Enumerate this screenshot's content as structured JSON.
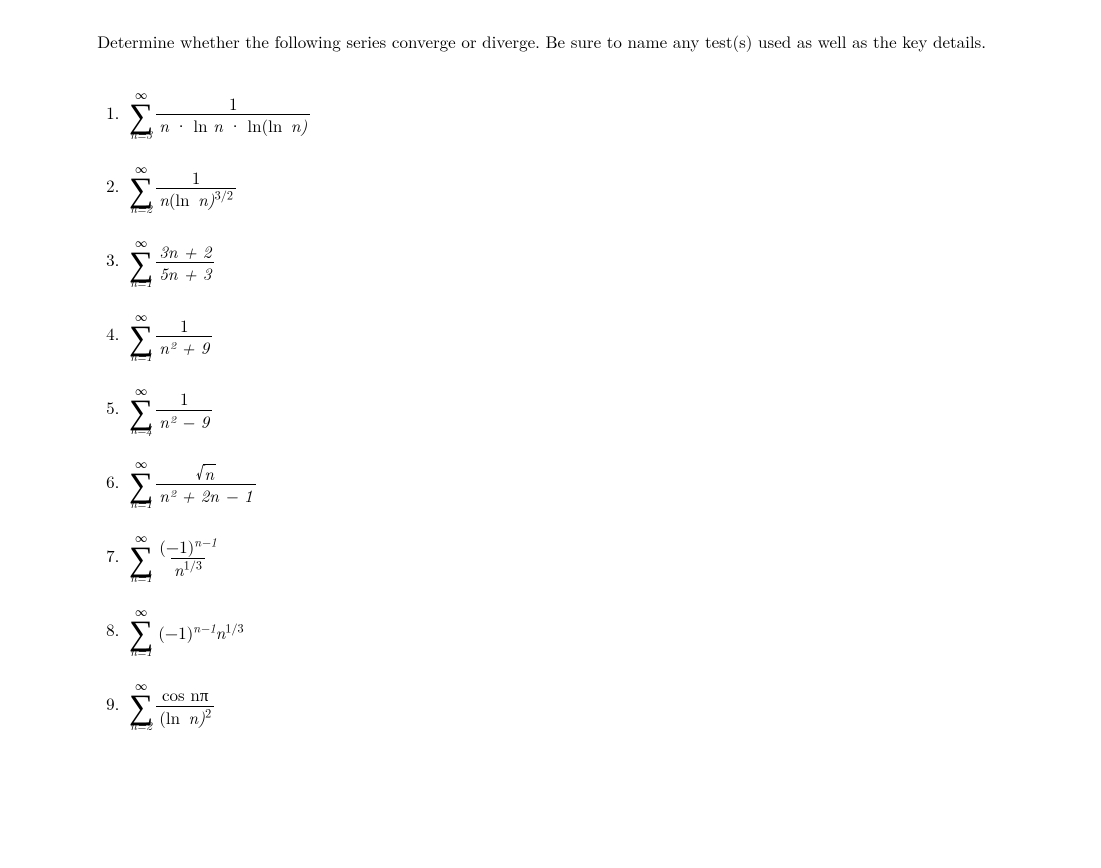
{
  "prompt": "Determine whether the following series converge or diverge. Be sure to name any test(s) used as well as the key details.",
  "sigma": {
    "symbol": "∑",
    "upper": "∞"
  },
  "problems": {
    "p1": {
      "lower": "n=3",
      "num": "1",
      "den_left": "n",
      "den_ln": "ln",
      "den_lnofln_l": "ln(ln",
      "den_lnofln_r": "n)"
    },
    "p2": {
      "lower": "n=2",
      "num": "1",
      "den_n": "n",
      "den_ln": "(ln",
      "den_n2": "n)",
      "den_exp": "3/2"
    },
    "p3": {
      "lower": "n=1",
      "num": "3n + 2",
      "den": "5n + 3"
    },
    "p4": {
      "lower": "n=1",
      "num": "1",
      "den": "n² + 9"
    },
    "p5": {
      "lower": "n=4",
      "num": "1",
      "den": "n² − 9"
    },
    "p6": {
      "lower": "n=1",
      "num_rad": "n",
      "den": "n² + 2n − 1"
    },
    "p7": {
      "lower": "n=1",
      "num_base": "(−1)",
      "num_exp": "n−1",
      "den_n": "n",
      "den_exp": "1/3"
    },
    "p8": {
      "lower": "n=1",
      "base": "(−1)",
      "exp": "n−1",
      "n": "n",
      "nexp": "1/3"
    },
    "p9": {
      "lower": "n=2",
      "num": "cos nπ",
      "den_pre": "(ln",
      "den_n": "n)",
      "den_exp": "2"
    }
  }
}
